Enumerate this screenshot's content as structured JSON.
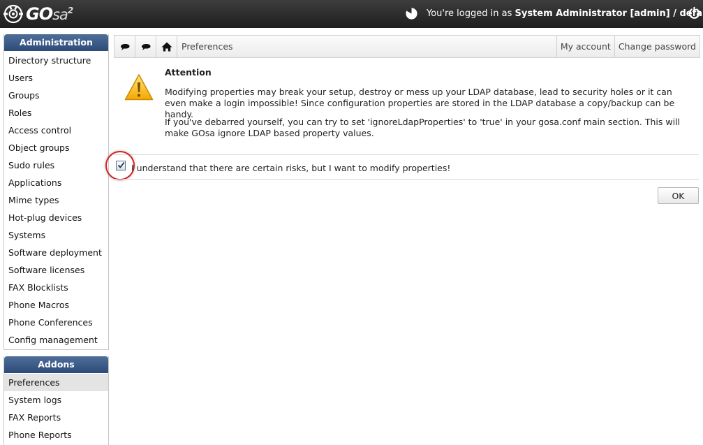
{
  "header": {
    "logo_text": "GO",
    "logo_text_suffix": "sa",
    "logo_sup": "2",
    "login_prefix": "You're logged in as ",
    "login_user": "System Administrator [admin] / default"
  },
  "sidebar": {
    "administration": {
      "title": "Administration",
      "items": [
        {
          "label": "Directory structure"
        },
        {
          "label": "Users"
        },
        {
          "label": "Groups"
        },
        {
          "label": "Roles"
        },
        {
          "label": "Access control"
        },
        {
          "label": "Object groups"
        },
        {
          "label": "Sudo rules"
        },
        {
          "label": "Applications"
        },
        {
          "label": "Mime types"
        },
        {
          "label": "Hot-plug devices"
        },
        {
          "label": "Systems"
        },
        {
          "label": "Software deployment"
        },
        {
          "label": "Software licenses"
        },
        {
          "label": "FAX Blocklists"
        },
        {
          "label": "Phone Macros"
        },
        {
          "label": "Phone Conferences"
        },
        {
          "label": "Config management"
        }
      ]
    },
    "addons": {
      "title": "Addons",
      "items": [
        {
          "label": "Preferences",
          "active": true
        },
        {
          "label": "System logs"
        },
        {
          "label": "FAX Reports"
        },
        {
          "label": "Phone Reports"
        }
      ]
    }
  },
  "navbar": {
    "icons": [
      "speech-bubble-icon",
      "speech-bubble-icon",
      "home-icon"
    ],
    "breadcrumb": "Preferences",
    "my_account": "My account",
    "change_password": "Change password"
  },
  "content": {
    "attention_title": "Attention",
    "paragraph1": "Modifying properties may break your setup, destroy or mess up your LDAP database, lead to security holes or it can even make a login impossible! Since configuration properties are stored in the LDAP database a copy/backup can be handy.",
    "paragraph2": "If you've debarred yourself, you can try to set 'ignoreLdapProperties' to 'true' in your gosa.conf main section. This will make GOsa ignore LDAP based property values.",
    "checkbox_label": "I understand that there are certain risks, but I want to modify properties!",
    "checkbox_checked": true,
    "ok_label": "OK"
  },
  "colors": {
    "topbar": "#2b2b2b",
    "menu_header": "#3b5a88",
    "highlight_ring": "#d42020",
    "warning": "#f5b400"
  }
}
